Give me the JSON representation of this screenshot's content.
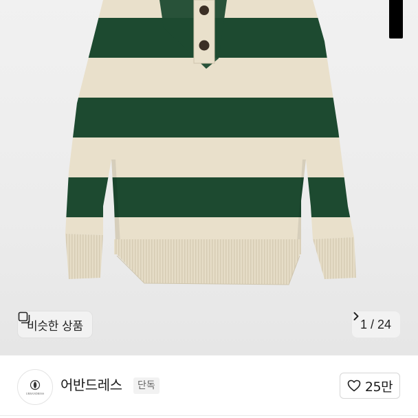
{
  "image_gallery": {
    "similar_button_label": "비슷한 상품",
    "similar_icon": "similar-items-icon",
    "pager_text": "1 / 24",
    "pager_icon": "chevron-right-icon"
  },
  "colors": {
    "stripe_green": "#1d4a30",
    "stripe_cream": "#e9e0cb",
    "chip_bg": "#f2f2f2",
    "like_border": "#d6d6d6"
  },
  "shop": {
    "logo_text": "URBANDRESS",
    "name": "어반드레스",
    "badge": "단독",
    "like_icon": "heart-icon",
    "like_count": "25만"
  }
}
